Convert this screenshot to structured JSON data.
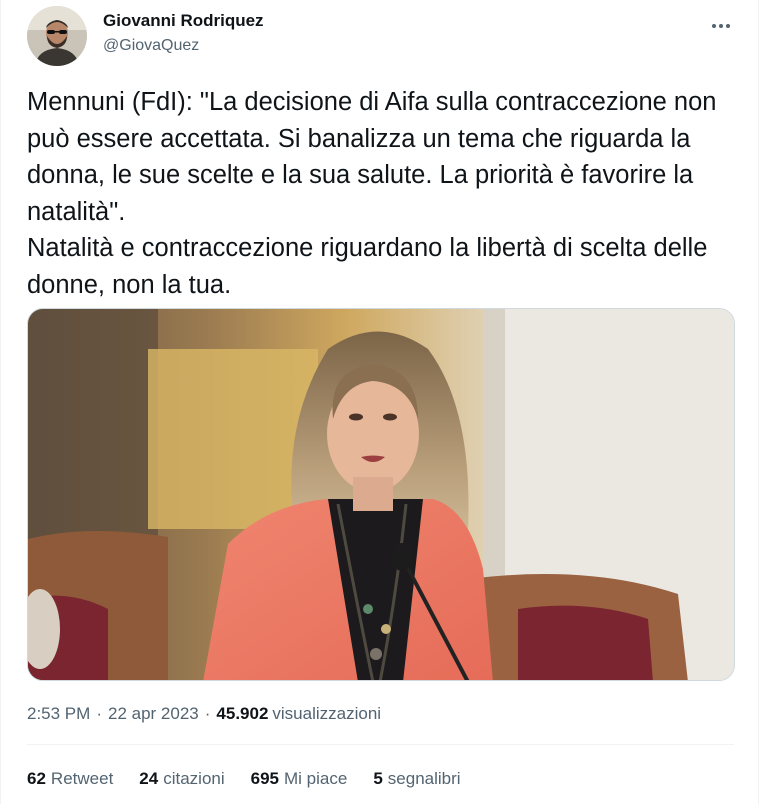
{
  "author": {
    "name": "Giovanni Rodriquez",
    "handle": "@GiovaQuez",
    "avatar_icon": "profile-photo"
  },
  "more_icon": "more-horizontal-icon",
  "tweet": {
    "text": "Mennuni (FdI): \"La decisione di Aifa sulla contraccezione non può essere accettata. Si banalizza un tema che riguarda la donna, le sue scelte e la sua salute. La priorità è favorire la natalità\".\nNatalità e contraccezione riguardano la libertà di scelta delle donne, non la tua.",
    "media_description": "photo"
  },
  "meta": {
    "time": "2:53 PM",
    "separator": "·",
    "date": "22 apr 2023",
    "views_count": "45.902",
    "views_label": "visualizzazioni"
  },
  "stats": {
    "retweets": {
      "count": "62",
      "label": "Retweet"
    },
    "quotes": {
      "count": "24",
      "label": "citazioni"
    },
    "likes": {
      "count": "695",
      "label": "Mi piace"
    },
    "bookmarks": {
      "count": "5",
      "label": "segnalibri"
    }
  },
  "colors": {
    "text_primary": "#0f1419",
    "text_secondary": "#536471",
    "divider": "#eff3f4"
  }
}
